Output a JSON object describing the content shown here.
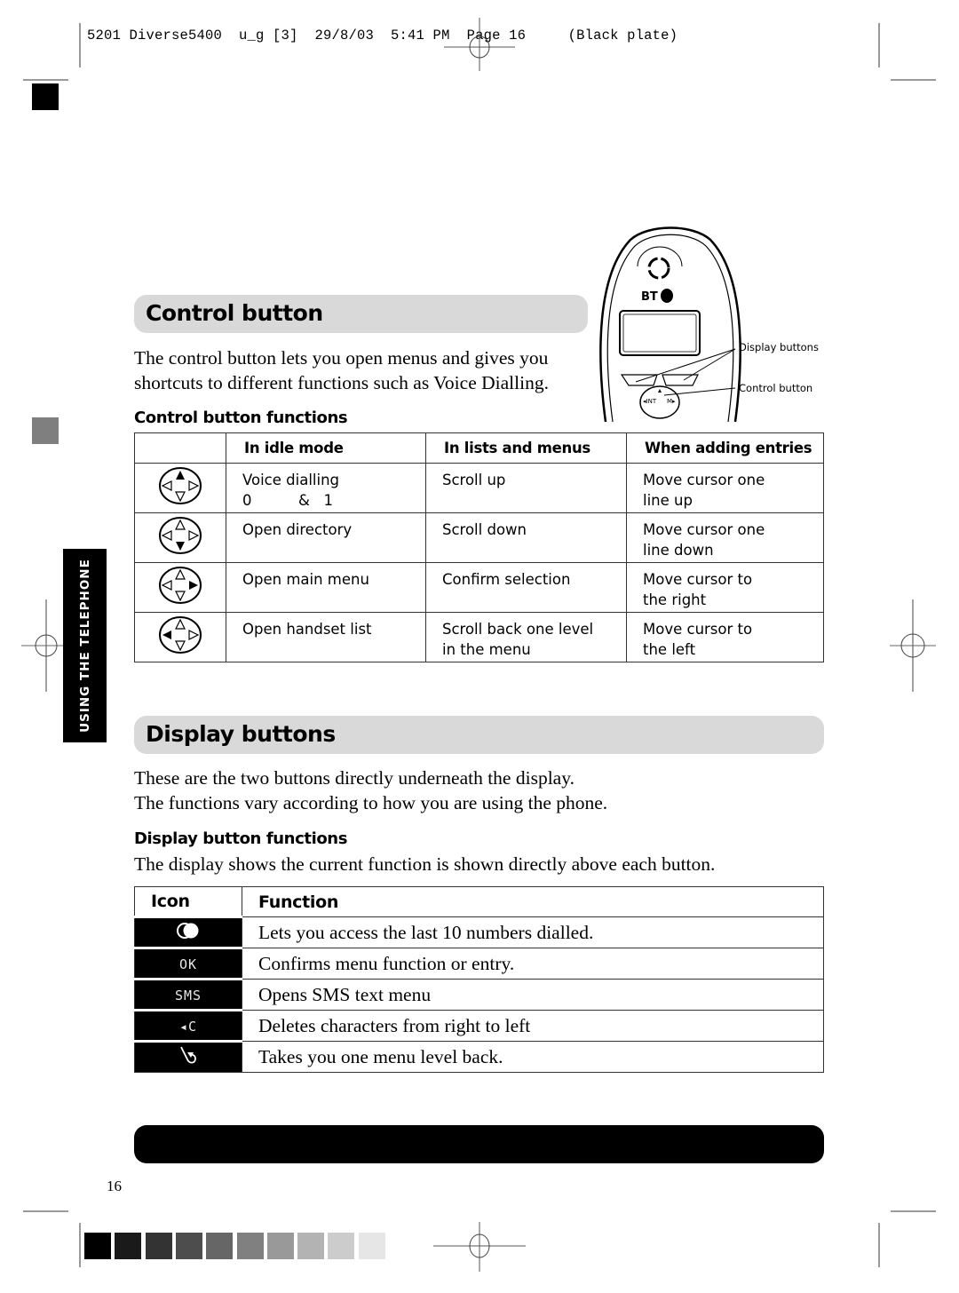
{
  "slug_line": "5201 Diverse5400  u_g [3]  29/8/03  5:41 PM  Page 16     (Black plate)",
  "side_tab": {
    "label": "USING THE TELEPHONE"
  },
  "control_section": {
    "title": "Control button",
    "intro": [
      "The control button lets you open menus and gives you",
      "shortcuts to different functions such as Voice Dialling."
    ],
    "subheading": "Control button functions",
    "table": {
      "headers": [
        "",
        "In idle mode",
        "In lists and menus",
        "When adding entries"
      ],
      "rows": [
        {
          "icon": "control-up-icon",
          "idle": [
            "Voice dialling",
            "0          &   1"
          ],
          "lists": [
            "Scroll up"
          ],
          "adding": [
            "Move cursor one",
            "line up"
          ]
        },
        {
          "icon": "control-down-icon",
          "idle": [
            "Open directory"
          ],
          "lists": [
            "Scroll down"
          ],
          "adding": [
            "Move cursor one",
            "line down"
          ]
        },
        {
          "icon": "control-right-icon",
          "idle": [
            "Open main menu"
          ],
          "lists": [
            "Confirm selection"
          ],
          "adding": [
            "Move cursor to",
            "the right"
          ]
        },
        {
          "icon": "control-left-icon",
          "idle": [
            "Open handset list"
          ],
          "lists": [
            "Scroll back one level",
            "in the menu"
          ],
          "adding": [
            "Move cursor to",
            "the left"
          ]
        }
      ]
    }
  },
  "phone_illustration": {
    "brand": "BT",
    "nav_left": "◂INT",
    "nav_right": "M▸",
    "callouts": {
      "display_buttons": "Display buttons",
      "control_button": "Control button"
    }
  },
  "display_section": {
    "title": "Display buttons",
    "intro": [
      "These are the two buttons directly underneath the display.",
      "The functions vary according to how you are using the phone."
    ],
    "subheading": "Display button functions",
    "subtext": "The display shows the current function is shown directly above each button.",
    "table": {
      "headers": [
        "Icon",
        "Function"
      ],
      "rows": [
        {
          "icon": "redial-icon",
          "icon_text": "",
          "function": "Lets you access the last 10 numbers dialled."
        },
        {
          "icon": "ok-icon",
          "icon_text": "OK",
          "function": "Confirms menu function or entry."
        },
        {
          "icon": "sms-icon",
          "icon_text": "SMS",
          "function": "Opens SMS text menu"
        },
        {
          "icon": "delete-icon",
          "icon_text": "◂C",
          "function": "Deletes characters from right to left"
        },
        {
          "icon": "back-icon",
          "icon_text": "",
          "function": "Takes you one menu level back."
        }
      ]
    }
  },
  "page_number": "16",
  "colors": {
    "section_bar": "#d9d9d9",
    "side_tab": "#000000",
    "grey_swatches": [
      "#000000",
      "#1a1a1a",
      "#333333",
      "#4d4d4d",
      "#666666",
      "#808080",
      "#999999",
      "#b3b3b3",
      "#cccccc",
      "#e6e6e6"
    ]
  }
}
